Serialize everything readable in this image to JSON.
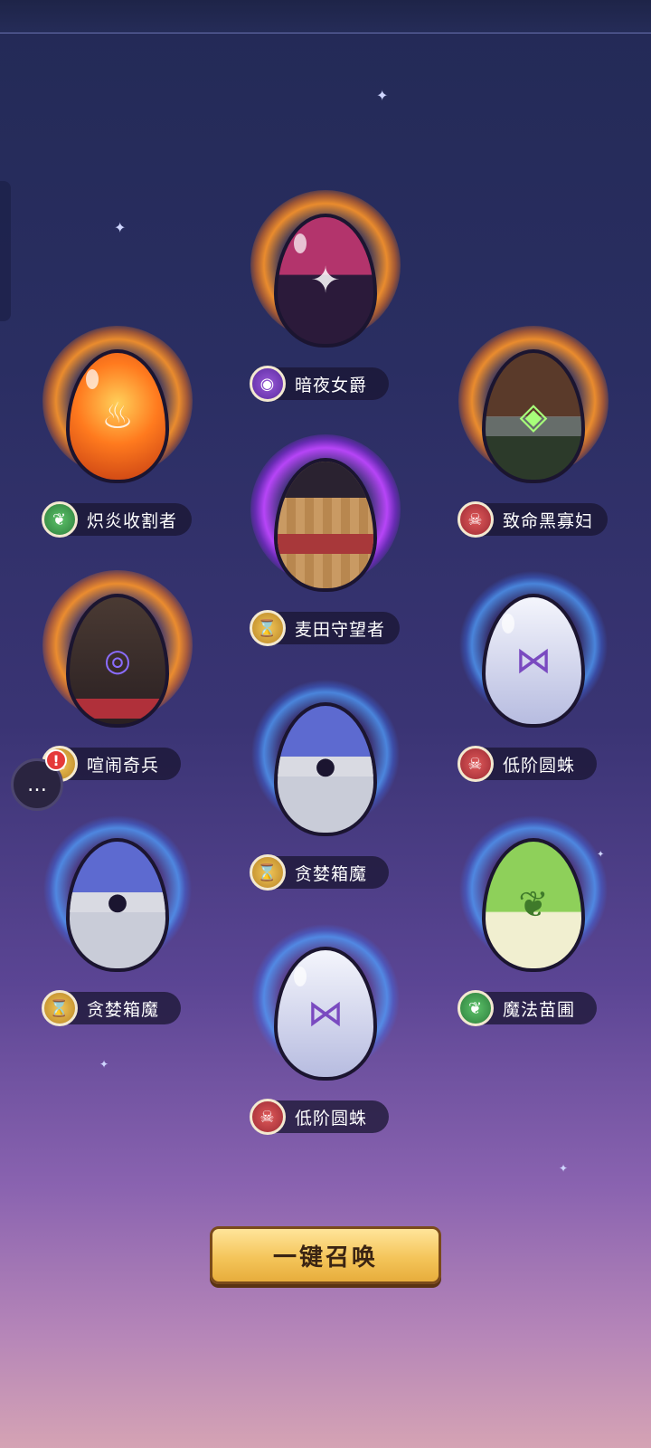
{
  "eggs": [
    {
      "name": "暗夜女爵",
      "badge": "eye-icon",
      "glyph": "◉",
      "rarity": "orange",
      "colors": [
        "#b3346c",
        "#2b1a3a"
      ]
    },
    {
      "name": "炽炎收割者",
      "badge": "leaf-icon",
      "glyph": "❦",
      "rarity": "orange",
      "colors": [
        "#ff7a1e",
        "#c23a12"
      ]
    },
    {
      "name": "致命黑寡妇",
      "badge": "skull-icon",
      "glyph": "☠",
      "rarity": "orange",
      "colors": [
        "#5a3a2a",
        "#2c3a2a"
      ]
    },
    {
      "name": "麦田守望者",
      "badge": "hourglass-icon",
      "glyph": "⌛",
      "rarity": "purple",
      "colors": [
        "#c99a63",
        "#8a5a32"
      ]
    },
    {
      "name": "喧闹奇兵",
      "badge": "skull-icon",
      "glyph": "☠",
      "rarity": "orange",
      "colors": [
        "#4a3a33",
        "#2a2022"
      ]
    },
    {
      "name": "低阶圆蛛",
      "badge": "skull-icon",
      "glyph": "☠",
      "rarity": "blue",
      "colors": [
        "#eef0fb",
        "#b7bce0"
      ]
    },
    {
      "name": "贪婪箱魔",
      "badge": "hourglass-icon",
      "glyph": "⌛",
      "rarity": "blue",
      "colors": [
        "#5d6ad0",
        "#c9ccd8"
      ]
    },
    {
      "name": "贪婪箱魔",
      "badge": "hourglass-icon",
      "glyph": "⌛",
      "rarity": "blue",
      "colors": [
        "#5d6ad0",
        "#c9ccd8"
      ]
    },
    {
      "name": "魔法苗圃",
      "badge": "leaf-icon",
      "glyph": "❦",
      "rarity": "blue",
      "colors": [
        "#8ed05a",
        "#f1efd0"
      ]
    },
    {
      "name": "低阶圆蛛",
      "badge": "skull-icon",
      "glyph": "☠",
      "rarity": "blue",
      "colors": [
        "#eef0fb",
        "#b7bce0"
      ]
    }
  ],
  "summon_button": "一键召唤",
  "chat_alert": "!",
  "chat_icon": "chat-icon"
}
